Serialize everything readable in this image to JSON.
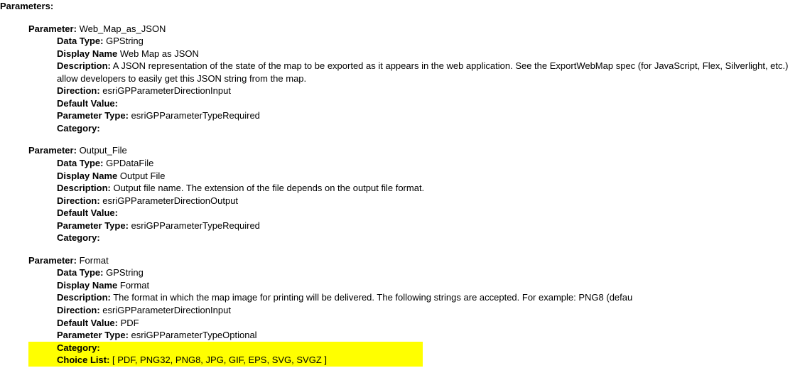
{
  "title": "Parameters:",
  "paramLabel": "Parameter:",
  "fields": {
    "dataType": "Data Type:",
    "displayName": "Display Name",
    "description": "Description:",
    "direction": "Direction:",
    "defaultValue": "Default Value:",
    "parameterType": "Parameter Type:",
    "category": "Category:",
    "choiceList": "Choice List:"
  },
  "parameters": [
    {
      "name": "Web_Map_as_JSON",
      "dataType": "GPString",
      "displayName": "Web Map as JSON",
      "description": "A JSON representation of the state of the map to be exported as it appears in the web application. See the ExportWebMap spec (for JavaScript, Flex, Silverlight, etc.) allow developers to easily get this JSON string from the map.",
      "direction": "esriGPParameterDirectionInput",
      "defaultValue": "",
      "parameterType": "esriGPParameterTypeRequired",
      "category": ""
    },
    {
      "name": "Output_File",
      "dataType": "GPDataFile",
      "displayName": "Output File",
      "description": "Output file name. The extension of the file depends on the output file format.",
      "direction": "esriGPParameterDirectionOutput",
      "defaultValue": "",
      "parameterType": "esriGPParameterTypeRequired",
      "category": ""
    },
    {
      "name": "Format",
      "dataType": "GPString",
      "displayName": "Format",
      "description": "The format in which the map image for printing will be delivered. The following strings are accepted. For example: PNG8 (defau",
      "direction": "esriGPParameterDirectionInput",
      "defaultValue": "PDF",
      "parameterType": "esriGPParameterTypeOptional",
      "category": "",
      "choiceList": "[ PDF, PNG32, PNG8, JPG, GIF, EPS, SVG, SVGZ ]"
    }
  ]
}
